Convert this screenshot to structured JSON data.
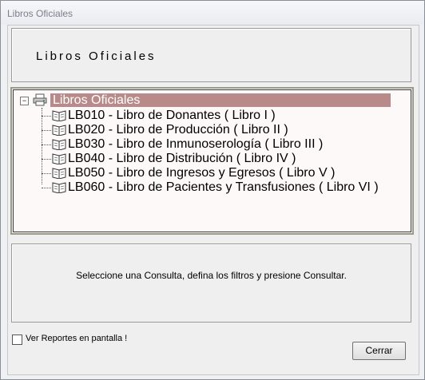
{
  "window": {
    "title": "Libros Oficiales"
  },
  "header": {
    "title": "Libros Oficiales"
  },
  "tree": {
    "root_label": "Libros Oficiales",
    "expander_symbol": "−",
    "items": [
      {
        "label": "LB010 - Libro de Donantes ( Libro I )"
      },
      {
        "label": "LB020 - Libro de Producción ( Libro II )"
      },
      {
        "label": "LB030 - Libro de Inmunoserología ( Libro III )"
      },
      {
        "label": "LB040 - Libro de Distribución ( Libro IV )"
      },
      {
        "label": "LB050 - Libro de Ingresos y Egresos ( Libro V )"
      },
      {
        "label": "LB060 - Libro de Pacientes y Transfusiones ( Libro VI )"
      }
    ]
  },
  "status": {
    "message": "Seleccione una Consulta, defina los filtros y presione Consultar."
  },
  "options": {
    "show_on_screen_label": "Ver Reportes en pantalla !",
    "show_on_screen_checked": false
  },
  "buttons": {
    "close_label": "Cerrar"
  },
  "colors": {
    "selection_bg": "#b98a8a",
    "tree_bg": "#fdf9f9",
    "panel_bg": "#efefef"
  },
  "icons": {
    "root": "printer-icon",
    "item": "book-icon"
  }
}
